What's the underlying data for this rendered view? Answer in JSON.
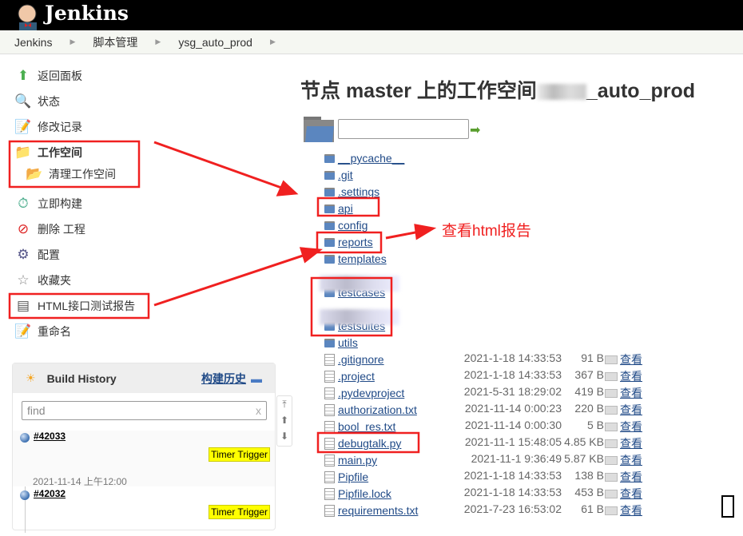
{
  "header": {
    "brand": "Jenkins"
  },
  "breadcrumb": [
    "Jenkins",
    "脚本管理",
    "ysg_auto_prod"
  ],
  "sidebar": [
    {
      "label": "返回面板",
      "icon": "arrow-up-icon"
    },
    {
      "label": "状态",
      "icon": "magnifier-icon"
    },
    {
      "label": "修改记录",
      "icon": "notepad-icon"
    },
    {
      "label": "工作空间",
      "icon": "folder-icon"
    },
    {
      "label": "清理工作空间",
      "icon": "folder-delete-icon"
    },
    {
      "label": "立即构建",
      "icon": "clock-icon"
    },
    {
      "label": "删除 工程",
      "icon": "no-entry-icon"
    },
    {
      "label": "配置",
      "icon": "gear-icon"
    },
    {
      "label": "收藏夹",
      "icon": "star-icon"
    },
    {
      "label": "HTML接口测试报告",
      "icon": "report-icon"
    },
    {
      "label": "重命名",
      "icon": "notepad-icon"
    }
  ],
  "build_history": {
    "title": "Build History",
    "link": "构建历史",
    "find_placeholder": "find",
    "clear": "x",
    "builds": [
      {
        "number": "#42033",
        "cause": "Timer Trigger",
        "time": "2021-11-14 上午12:00"
      },
      {
        "number": "#42032",
        "cause": "Timer Trigger"
      }
    ]
  },
  "main": {
    "title_prefix": "节点 master 上的工作空间",
    "title_suffix": "_auto_prod",
    "folders": [
      "__pycache__",
      ".git",
      ".settings",
      "api",
      "config",
      "reports",
      "templates",
      "testcases",
      "testsuites",
      "utils"
    ],
    "view_label": "查看",
    "files": [
      {
        "name": ".gitignore",
        "date": "2021-1-18 14:33:53",
        "size": "91 B"
      },
      {
        "name": ".project",
        "date": "2021-1-18 14:33:53",
        "size": "367 B"
      },
      {
        "name": ".pydevproject",
        "date": "2021-5-31 18:29:02",
        "size": "419 B"
      },
      {
        "name": "authorization.txt",
        "date": "2021-11-14 0:00:23",
        "size": "220 B"
      },
      {
        "name": "bool_res.txt",
        "date": "2021-11-14 0:00:30",
        "size": "5 B"
      },
      {
        "name": "debugtalk.py",
        "date": "2021-11-1 15:48:05",
        "size": "4.85 KB"
      },
      {
        "name": "main.py",
        "date": "2021-11-1 9:36:49",
        "size": "5.87 KB"
      },
      {
        "name": "Pipfile",
        "date": "2021-1-18 14:33:53",
        "size": "138 B"
      },
      {
        "name": "Pipfile.lock",
        "date": "2021-1-18 14:33:53",
        "size": "453 B"
      },
      {
        "name": "requirements.txt",
        "date": "2021-7-23 16:53:02",
        "size": "61 B"
      }
    ]
  },
  "annotation": {
    "note": "查看html报告",
    "color": "#f02020"
  }
}
